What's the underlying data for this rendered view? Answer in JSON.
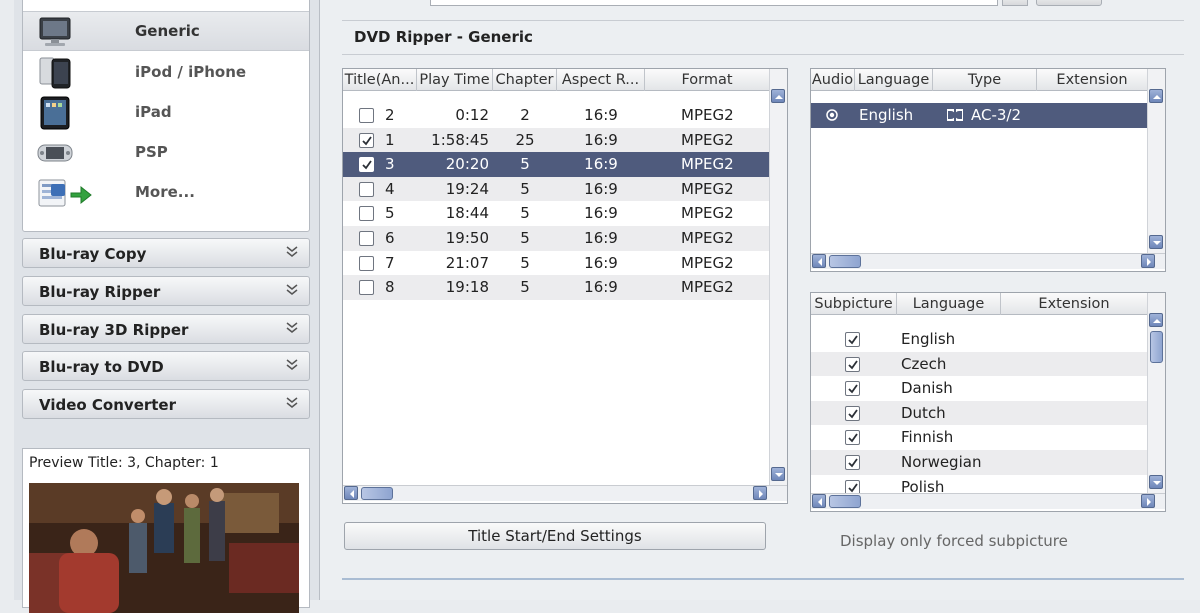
{
  "sidebar": {
    "devices": [
      {
        "label": "Generic",
        "icon": "monitor-icon",
        "selected": true
      },
      {
        "label": "iPod / iPhone",
        "icon": "ipod-icon",
        "selected": false
      },
      {
        "label": "iPad",
        "icon": "ipad-icon",
        "selected": false
      },
      {
        "label": "PSP",
        "icon": "psp-icon",
        "selected": false
      },
      {
        "label": "More...",
        "icon": "more-devices-icon",
        "selected": false
      }
    ],
    "categories": [
      {
        "label": "Blu-ray Copy"
      },
      {
        "label": "Blu-ray Ripper"
      },
      {
        "label": "Blu-ray 3D Ripper"
      },
      {
        "label": "Blu-ray to DVD"
      },
      {
        "label": "Video Converter"
      }
    ],
    "preview": {
      "label": "Preview Title: 3, Chapter: 1"
    }
  },
  "main": {
    "section_title": "DVD Ripper - Generic",
    "titles_table": {
      "columns": [
        "Title(An...",
        "Play Time",
        "Chapter",
        "Aspect R...",
        "Format"
      ],
      "rows": [
        {
          "checked": false,
          "title": "2",
          "time": "0:12",
          "chapter": "2",
          "aspect": "16:9",
          "format": "MPEG2",
          "selected": false
        },
        {
          "checked": true,
          "title": "1",
          "time": "1:58:45",
          "chapter": "25",
          "aspect": "16:9",
          "format": "MPEG2",
          "selected": false
        },
        {
          "checked": true,
          "title": "3",
          "time": "20:20",
          "chapter": "5",
          "aspect": "16:9",
          "format": "MPEG2",
          "selected": true
        },
        {
          "checked": false,
          "title": "4",
          "time": "19:24",
          "chapter": "5",
          "aspect": "16:9",
          "format": "MPEG2",
          "selected": false
        },
        {
          "checked": false,
          "title": "5",
          "time": "18:44",
          "chapter": "5",
          "aspect": "16:9",
          "format": "MPEG2",
          "selected": false
        },
        {
          "checked": false,
          "title": "6",
          "time": "19:50",
          "chapter": "5",
          "aspect": "16:9",
          "format": "MPEG2",
          "selected": false
        },
        {
          "checked": false,
          "title": "7",
          "time": "21:07",
          "chapter": "5",
          "aspect": "16:9",
          "format": "MPEG2",
          "selected": false
        },
        {
          "checked": false,
          "title": "8",
          "time": "19:18",
          "chapter": "5",
          "aspect": "16:9",
          "format": "MPEG2",
          "selected": false
        }
      ]
    },
    "audio_table": {
      "columns": [
        "Audio",
        "Language",
        "Type",
        "Extension"
      ],
      "rows": [
        {
          "language": "English",
          "type": "AC-3/2",
          "selected": true
        }
      ]
    },
    "subpicture_table": {
      "columns": [
        "Subpicture",
        "Language",
        "Extension"
      ],
      "rows": [
        {
          "checked": true,
          "language": "English"
        },
        {
          "checked": true,
          "language": "Czech"
        },
        {
          "checked": true,
          "language": "Danish"
        },
        {
          "checked": true,
          "language": "Dutch"
        },
        {
          "checked": true,
          "language": "Finnish"
        },
        {
          "checked": true,
          "language": "Norwegian"
        },
        {
          "checked": true,
          "language": "Polish"
        }
      ]
    },
    "title_settings_button": "Title Start/End Settings",
    "forced_subpicture_label": "Display only forced subpicture"
  },
  "colors": {
    "selection": "#4f5b7d",
    "scroll_button": "#7f95c4",
    "alt_row": "#ececee"
  }
}
